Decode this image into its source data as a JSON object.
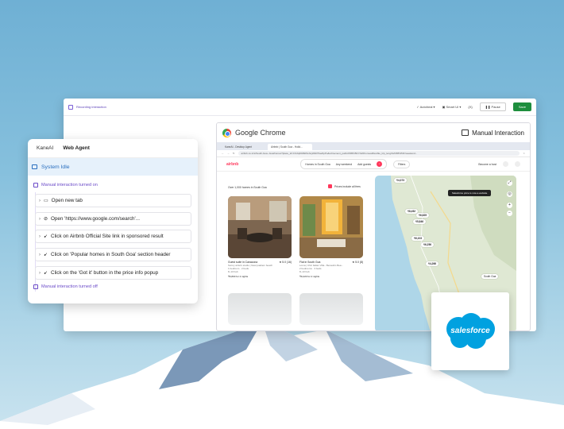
{
  "recorder": {
    "status": "Recording interaction",
    "autoheal": "Autoheal",
    "smart_ui": "Smart UI",
    "vars": "{X}",
    "pause": "Pause",
    "save": "Save"
  },
  "chrome": {
    "title": "Google Chrome",
    "mode": "Manual Interaction",
    "tabs": [
      "KaneAI - Desktop Agent",
      "Airbnb | South Goa - Holid..."
    ],
    "url": "airbnb.co.in/s/South-Goa--Goa/homes?place_id=ChIJqb6bBdSvhnjWAPr5ae5pPo&refinement_paths%5B%5D=%2Fhomes&flexible_trip_lengths%5B%5D=weekend..."
  },
  "airbnb": {
    "logo": "airbnb",
    "search_location": "Homes in South Goa",
    "search_dates": "Any weekend",
    "search_guests": "Add guests",
    "filters": "Filters",
    "host": "Become a host",
    "listing_count": "Over 1,000 homes in South Goa",
    "price_note": "Prices include all fees",
    "cards": [
      {
        "title": "Guest suite in Canacona",
        "rating": "★ 5.0 (16)",
        "desc": "Sunny artist's studio | Near palolem beach",
        "beds": "1 bedroom · 2 beds",
        "dates": "8–13 Feb",
        "price": "₹6,800 for 2 nights"
      },
      {
        "title": "Flat in South Goa",
        "rating": "★ 5.0 (8)",
        "desc": "Loma | Chic Italian Villa - Benaulim Bea...",
        "beds": "2 bedrooms · 3 beds",
        "dates": "8–13 Feb",
        "price": "₹9,220 for 2 nights"
      }
    ],
    "map": {
      "tooltip": "Salesforce price is now a website",
      "pins": [
        "₹4,373",
        "₹8,452",
        "₹6,825",
        "₹5,846",
        "₹6,103",
        "₹6,256",
        "₹4,266"
      ],
      "place": "South Goa"
    }
  },
  "kane": {
    "tabs": [
      "KaneAI",
      "Web Agent"
    ],
    "status": "System Idle",
    "manual_on": "Manual interaction turned on",
    "steps": [
      {
        "icon": "tab-icon",
        "glyph": "▭",
        "label": "Open new tab"
      },
      {
        "icon": "link-icon",
        "glyph": "⊘",
        "label": "Open 'https://www.google.com/search'..."
      },
      {
        "icon": "cursor-icon",
        "glyph": "➹",
        "label": "Click on Airbnb Official Site link in sponsored result"
      },
      {
        "icon": "cursor-icon",
        "glyph": "➹",
        "label": "Click on 'Popular homes in South Goa' section header"
      },
      {
        "icon": "cursor-icon",
        "glyph": "➹",
        "label": "Click on the 'Got it' button in the price info popup"
      }
    ],
    "manual_off": "Manual interaction turned off"
  },
  "brand": {
    "name": "salesforce",
    "color": "#00a1e0"
  }
}
